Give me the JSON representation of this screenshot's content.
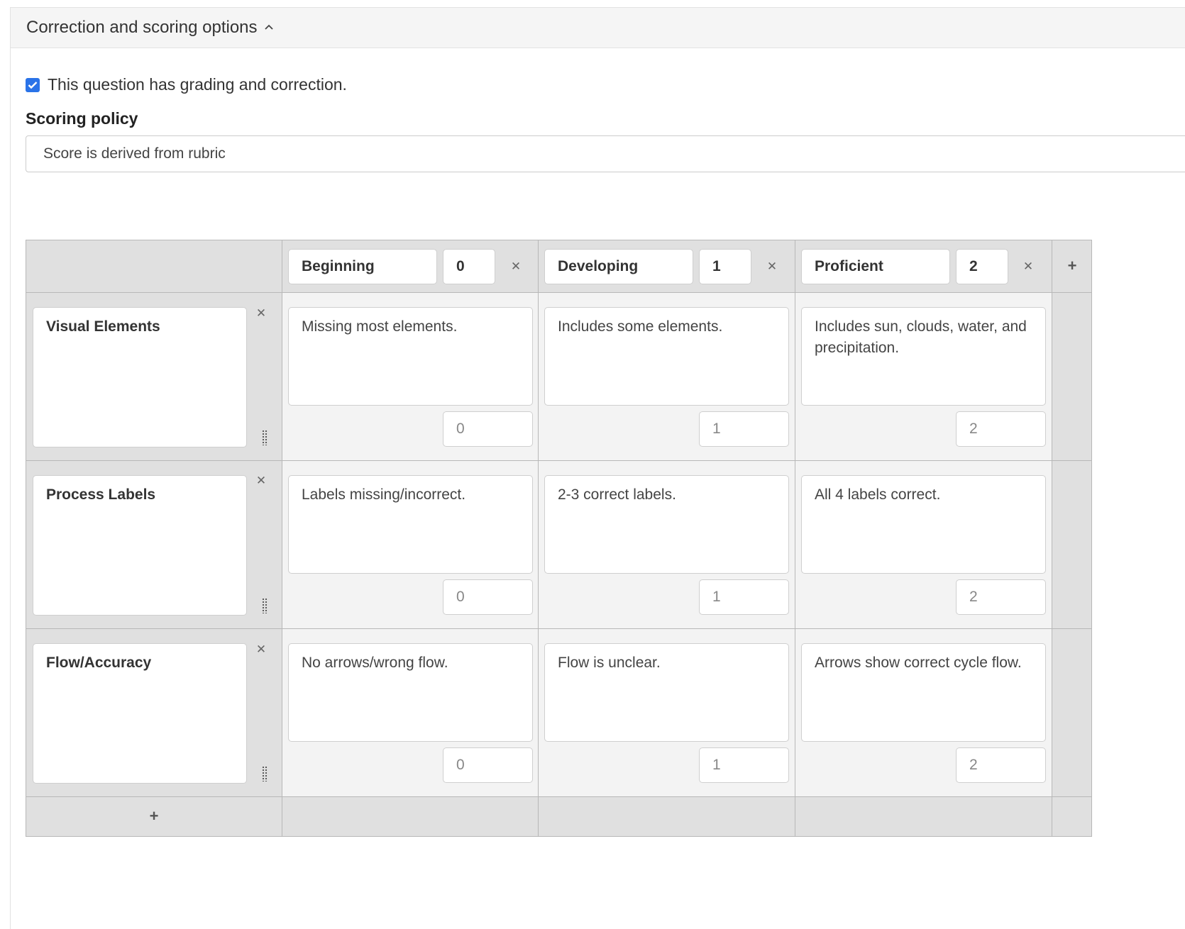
{
  "section": {
    "title": "Correction and scoring options",
    "chevron_icon": "chevron-up-icon"
  },
  "grading": {
    "checkbox_checked": true,
    "label": "This question has grading and correction."
  },
  "scoring_policy": {
    "label": "Scoring policy",
    "value": "Score is derived from rubric"
  },
  "rubric": {
    "levels": [
      {
        "name": "Beginning",
        "points": "0"
      },
      {
        "name": "Developing",
        "points": "1"
      },
      {
        "name": "Proficient",
        "points": "2"
      }
    ],
    "criteria": [
      {
        "name": "Visual Elements",
        "cells": [
          {
            "text": "Missing most elements.",
            "points": "0"
          },
          {
            "text": "Includes some elements.",
            "points": "1"
          },
          {
            "text": "Includes sun, clouds, water, and precipitation.",
            "points": "2"
          }
        ]
      },
      {
        "name": "Process Labels",
        "cells": [
          {
            "text": "Labels missing/incorrect.",
            "points": "0"
          },
          {
            "text": "2-3 correct labels.",
            "points": "1"
          },
          {
            "text": "All 4 labels correct.",
            "points": "2"
          }
        ]
      },
      {
        "name": "Flow/Accuracy",
        "cells": [
          {
            "text": "No arrows/wrong flow.",
            "points": "0"
          },
          {
            "text": "Flow is unclear.",
            "points": "1"
          },
          {
            "text": "Arrows show correct cycle flow.",
            "points": "2"
          }
        ]
      }
    ],
    "icons": {
      "remove": "close-icon",
      "add": "plus-icon",
      "drag": "drag-handle-icon"
    }
  },
  "colors": {
    "accent": "#2a73e8",
    "grid_bg": "#e0e0e0",
    "cell_bg": "#f3f3f3",
    "border": "#b8b8b8"
  }
}
